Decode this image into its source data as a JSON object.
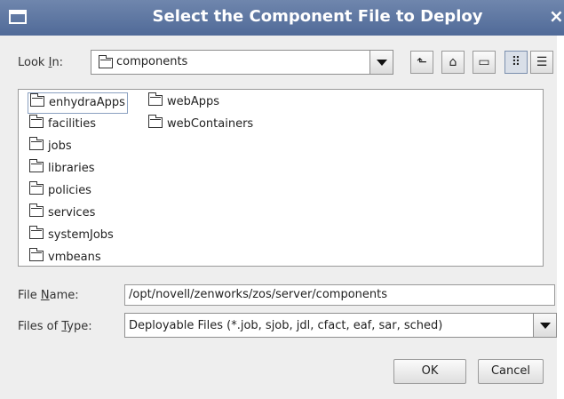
{
  "window": {
    "title": "Select the Component File to Deploy",
    "close_glyph": "×"
  },
  "look_in": {
    "label_pre": "Look ",
    "label_mnemonic": "I",
    "label_post": "n:",
    "value": "components"
  },
  "toolbar": {
    "buttons": [
      {
        "name": "up-one-level-icon",
        "glyph": "⬑"
      },
      {
        "name": "home-icon",
        "glyph": "⌂"
      },
      {
        "name": "new-folder-icon",
        "glyph": "▭"
      },
      {
        "name": "list-view-icon",
        "glyph": "⠿"
      },
      {
        "name": "details-view-icon",
        "glyph": "☰"
      }
    ]
  },
  "files": [
    "enhydraApps",
    "facilities",
    "jobs",
    "libraries",
    "policies",
    "services",
    "systemJobs",
    "vmbeans",
    "webApps",
    "webContainers"
  ],
  "file_name": {
    "label_pre": "File ",
    "label_mnemonic": "N",
    "label_post": "ame:",
    "value": "/opt/novell/zenworks/zos/server/components"
  },
  "file_type": {
    "label_pre": "Files of ",
    "label_mnemonic": "T",
    "label_post": "ype:",
    "value": "Deployable Files (*.job, sjob, jdl, cfact, eaf, sar, sched)"
  },
  "buttons": {
    "ok": "OK",
    "cancel": "Cancel"
  },
  "colors": {
    "titlebar": "#506a98",
    "panel": "#eeeeee",
    "selection_border": "#8aa0c0"
  }
}
